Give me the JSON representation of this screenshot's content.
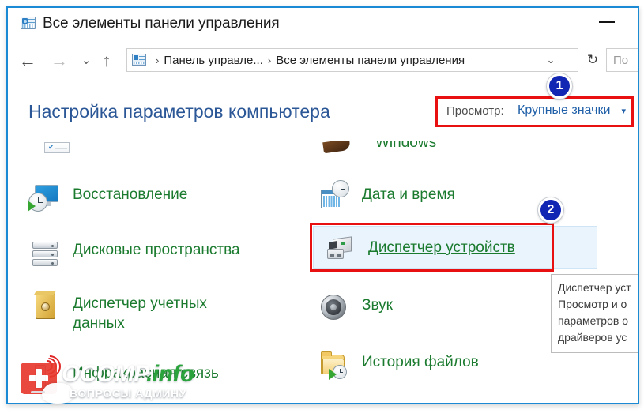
{
  "window": {
    "title": "Все элементы панели управления",
    "title_icon": "control-panel-icon",
    "minimize_label": "—",
    "border_color": "#1a8ad4"
  },
  "nav": {
    "back_icon": "←",
    "forward_icon": "→",
    "recent_icon": "⌄",
    "up_icon": "↑",
    "refresh_icon": "↻",
    "address_icon": "control-panel-icon",
    "breadcrumbs": [
      {
        "label": "Панель управле..."
      },
      {
        "label": "Все элементы панели управления"
      }
    ],
    "separator": "›",
    "dropdown_caret": "⌄",
    "search_placeholder": "По"
  },
  "content": {
    "page_title": "Настройка параметров компьютера",
    "view_selector": {
      "label": "Просмотр:",
      "value": "Крупные значки",
      "caret": "▾",
      "highlight_color": "#e81010"
    },
    "partial_top_row": {
      "right_label": "Windows"
    },
    "items": [
      {
        "label": "Восстановление",
        "icon": "recovery-icon",
        "column": "left",
        "row": 1,
        "hovered": false
      },
      {
        "label": "Дата и время",
        "icon": "date-time-icon",
        "column": "right",
        "row": 1,
        "hovered": false
      },
      {
        "label": "Дисковые пространства",
        "icon": "storage-spaces-icon",
        "column": "left",
        "row": 2,
        "hovered": false
      },
      {
        "label": "Диспетчер устройств",
        "icon": "device-manager-icon",
        "column": "right",
        "row": 2,
        "hovered": true
      },
      {
        "label": "Диспетчер учетных\nданных",
        "icon": "credential-manager-icon",
        "column": "left",
        "row": 3,
        "hovered": false
      },
      {
        "label": "Звук",
        "icon": "sound-icon",
        "column": "right",
        "row": 3,
        "hovered": false
      },
      {
        "label": "Инфракрасная связь",
        "icon": "infrared-icon",
        "column": "left",
        "row": 4,
        "hovered": false
      },
      {
        "label": "История файлов",
        "icon": "file-history-icon",
        "column": "right",
        "row": 4,
        "hovered": false
      }
    ]
  },
  "tooltip": {
    "title": "Диспетчер уст",
    "body": "Просмотр и о\nпараметров о\nдрайверов ус"
  },
  "badges": [
    {
      "number": "1",
      "color": "#1226b4"
    },
    {
      "number": "2",
      "color": "#1226b4"
    }
  ],
  "watermark": {
    "brand_white": "OCOMP",
    "brand_green": ".info",
    "subtitle": "ВОПРОСЫ АДМИНУ",
    "plus_color": "#e8392e"
  }
}
